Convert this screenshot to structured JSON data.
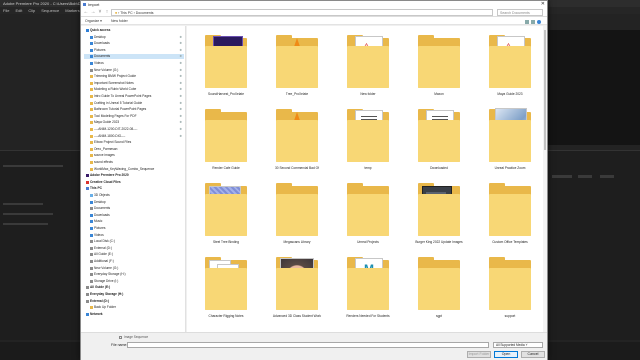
{
  "premiere": {
    "title": "Adobe Premiere Pro 2020 - C:\\Users\\Bob\\Documents\\Adobe\\Premiere Pro\\14.0\\Untitled.prproj",
    "menu": [
      "File",
      "Edit",
      "Clip",
      "Sequence",
      "Markers",
      "Graphics and Titles"
    ]
  },
  "dialog": {
    "title": "Import",
    "address": [
      "This PC",
      "Documents"
    ],
    "search_placeholder": "Search Documents",
    "toolbar": {
      "organize": "Organize ▾",
      "new_folder": "New folder"
    },
    "sidebar": [
      {
        "label": "Quick access",
        "type": "head",
        "color": "#2f7fd6"
      },
      {
        "label": "Desktop",
        "pin": true,
        "color": "#3a86d6"
      },
      {
        "label": "Downloads",
        "pin": true,
        "color": "#3a86d6"
      },
      {
        "label": "Pictures",
        "pin": true,
        "color": "#3a86d6"
      },
      {
        "label": "Documents",
        "pin": true,
        "selected": true,
        "color": "#3a86d6"
      },
      {
        "label": "Videos",
        "pin": true,
        "color": "#3a86d6"
      },
      {
        "label": "New Volume (G:)",
        "pin": true,
        "color": "#8c8c8c"
      },
      {
        "label": "Trimming BMW Project Guide",
        "pin": true,
        "color": "#e8b84a"
      },
      {
        "label": "Important Screenshot Notes",
        "pin": true,
        "color": "#e8b84a"
      },
      {
        "label": "Modeling a Rubix World Cube",
        "pin": true,
        "color": "#e8b84a"
      },
      {
        "label": "Intro Guide To Unreal PowerPoint Pages",
        "pin": true,
        "color": "#e8b84a"
      },
      {
        "label": "Crafting in Unreal 5 Tutorial Guide",
        "pin": true,
        "color": "#e8b84a"
      },
      {
        "label": "Bathroom Tutorial PowerPoint Pages",
        "pin": true,
        "color": "#e8b84a"
      },
      {
        "label": "Tool Modeling Pages For PDF",
        "pin": true,
        "color": "#e8b84a"
      },
      {
        "label": "Maya Guide 2023",
        "pin": true,
        "color": "#e8b84a"
      },
      {
        "label": "----ANIM-1200-DIT-2022-08----",
        "pin": true,
        "color": "#e8b84a"
      },
      {
        "label": "----ANIM-1800-DIG----",
        "pin": true,
        "color": "#e8b84a"
      },
      {
        "label": "Elbow Project Sound Files",
        "color": "#e8b84a"
      },
      {
        "label": "Oreo_Parmesan",
        "color": "#e8b84a"
      },
      {
        "label": "source images",
        "color": "#e8b84a"
      },
      {
        "label": "sound effects",
        "color": "#e8b84a"
      },
      {
        "label": "WorldMax_KeyWaving_Combo_Sequence",
        "color": "#e8b84a"
      },
      {
        "label": "Adobe Premiere Pro 2020",
        "type": "head",
        "color": "#3a1d6a"
      },
      {
        "label": "Creative Cloud Files",
        "type": "head",
        "color": "#d9322e"
      },
      {
        "label": "This PC",
        "type": "head",
        "color": "#4a7bd0"
      },
      {
        "label": "3D Objects",
        "color": "#6ab0e8"
      },
      {
        "label": "Desktop",
        "color": "#3a86d6"
      },
      {
        "label": "Documents",
        "color": "#8c8c8c"
      },
      {
        "label": "Downloads",
        "color": "#3a86d6"
      },
      {
        "label": "Music",
        "color": "#3a86d6"
      },
      {
        "label": "Pictures",
        "color": "#3a86d6"
      },
      {
        "label": "Videos",
        "color": "#3a86d6"
      },
      {
        "label": "Local Disk (C:)",
        "color": "#8c8c8c"
      },
      {
        "label": "External (D:)",
        "color": "#8c8c8c"
      },
      {
        "label": "All Guide (E:)",
        "color": "#8c8c8c"
      },
      {
        "label": "Additional (F:)",
        "color": "#8c8c8c"
      },
      {
        "label": "New Volume (G:)",
        "color": "#8c8c8c"
      },
      {
        "label": "Everyday Storage (H:)",
        "color": "#8c8c8c"
      },
      {
        "label": "Storage Drive (I:)",
        "color": "#8c8c8c"
      },
      {
        "label": "All Guide (E:)",
        "type": "head",
        "color": "#8c8c8c"
      },
      {
        "label": "Everyday Storage (H:)",
        "type": "head",
        "color": "#8c8c8c"
      },
      {
        "label": "External (D:)",
        "type": "head",
        "color": "#8c8c8c"
      },
      {
        "label": "Back Up Folder",
        "color": "#e8b84a"
      },
      {
        "label": "Network",
        "type": "head",
        "color": "#3a86d6"
      }
    ],
    "files": [
      {
        "label": "SoundHarvest_ProXelate",
        "kind": "pr"
      },
      {
        "label": "Tree_ProXelate",
        "kind": "vlc"
      },
      {
        "label": "New folder",
        "kind": "pdf"
      },
      {
        "label": "Maxon",
        "kind": "folder"
      },
      {
        "label": "Maya Guide 2023",
        "kind": "pdf"
      },
      {
        "label": "Render Cafe Guide",
        "kind": "folder"
      },
      {
        "label": "30 Second Commercial Bad Of",
        "kind": "vlc"
      },
      {
        "label": "temp",
        "kind": "json"
      },
      {
        "label": "Downloaded",
        "kind": "json"
      },
      {
        "label": "Unreal Practice Zoom",
        "kind": "art"
      },
      {
        "label": "Steel Tree Binding",
        "kind": "fabric"
      },
      {
        "label": "Megascans Library",
        "kind": "folder"
      },
      {
        "label": "Unreal Projects",
        "kind": "folder"
      },
      {
        "label": "Burger King 2022 Update Images",
        "kind": "dark"
      },
      {
        "label": "Custom Office Templates",
        "kind": "folder"
      },
      {
        "label": "Character Rigging Notes",
        "kind": "docs"
      },
      {
        "label": "Advanced 3D Class Student Work",
        "kind": "photo"
      },
      {
        "label": "Renders Needed For Students",
        "kind": "mb"
      },
      {
        "label": "sgpt",
        "kind": "folder"
      },
      {
        "label": "support",
        "kind": "folder"
      }
    ],
    "image_sequence_label": "Image Sequence",
    "file_name_label": "File name:",
    "filter": "All Supported Media",
    "import_folder_btn": "Import Folder",
    "open_btn": "Open",
    "cancel_btn": "Cancel"
  }
}
